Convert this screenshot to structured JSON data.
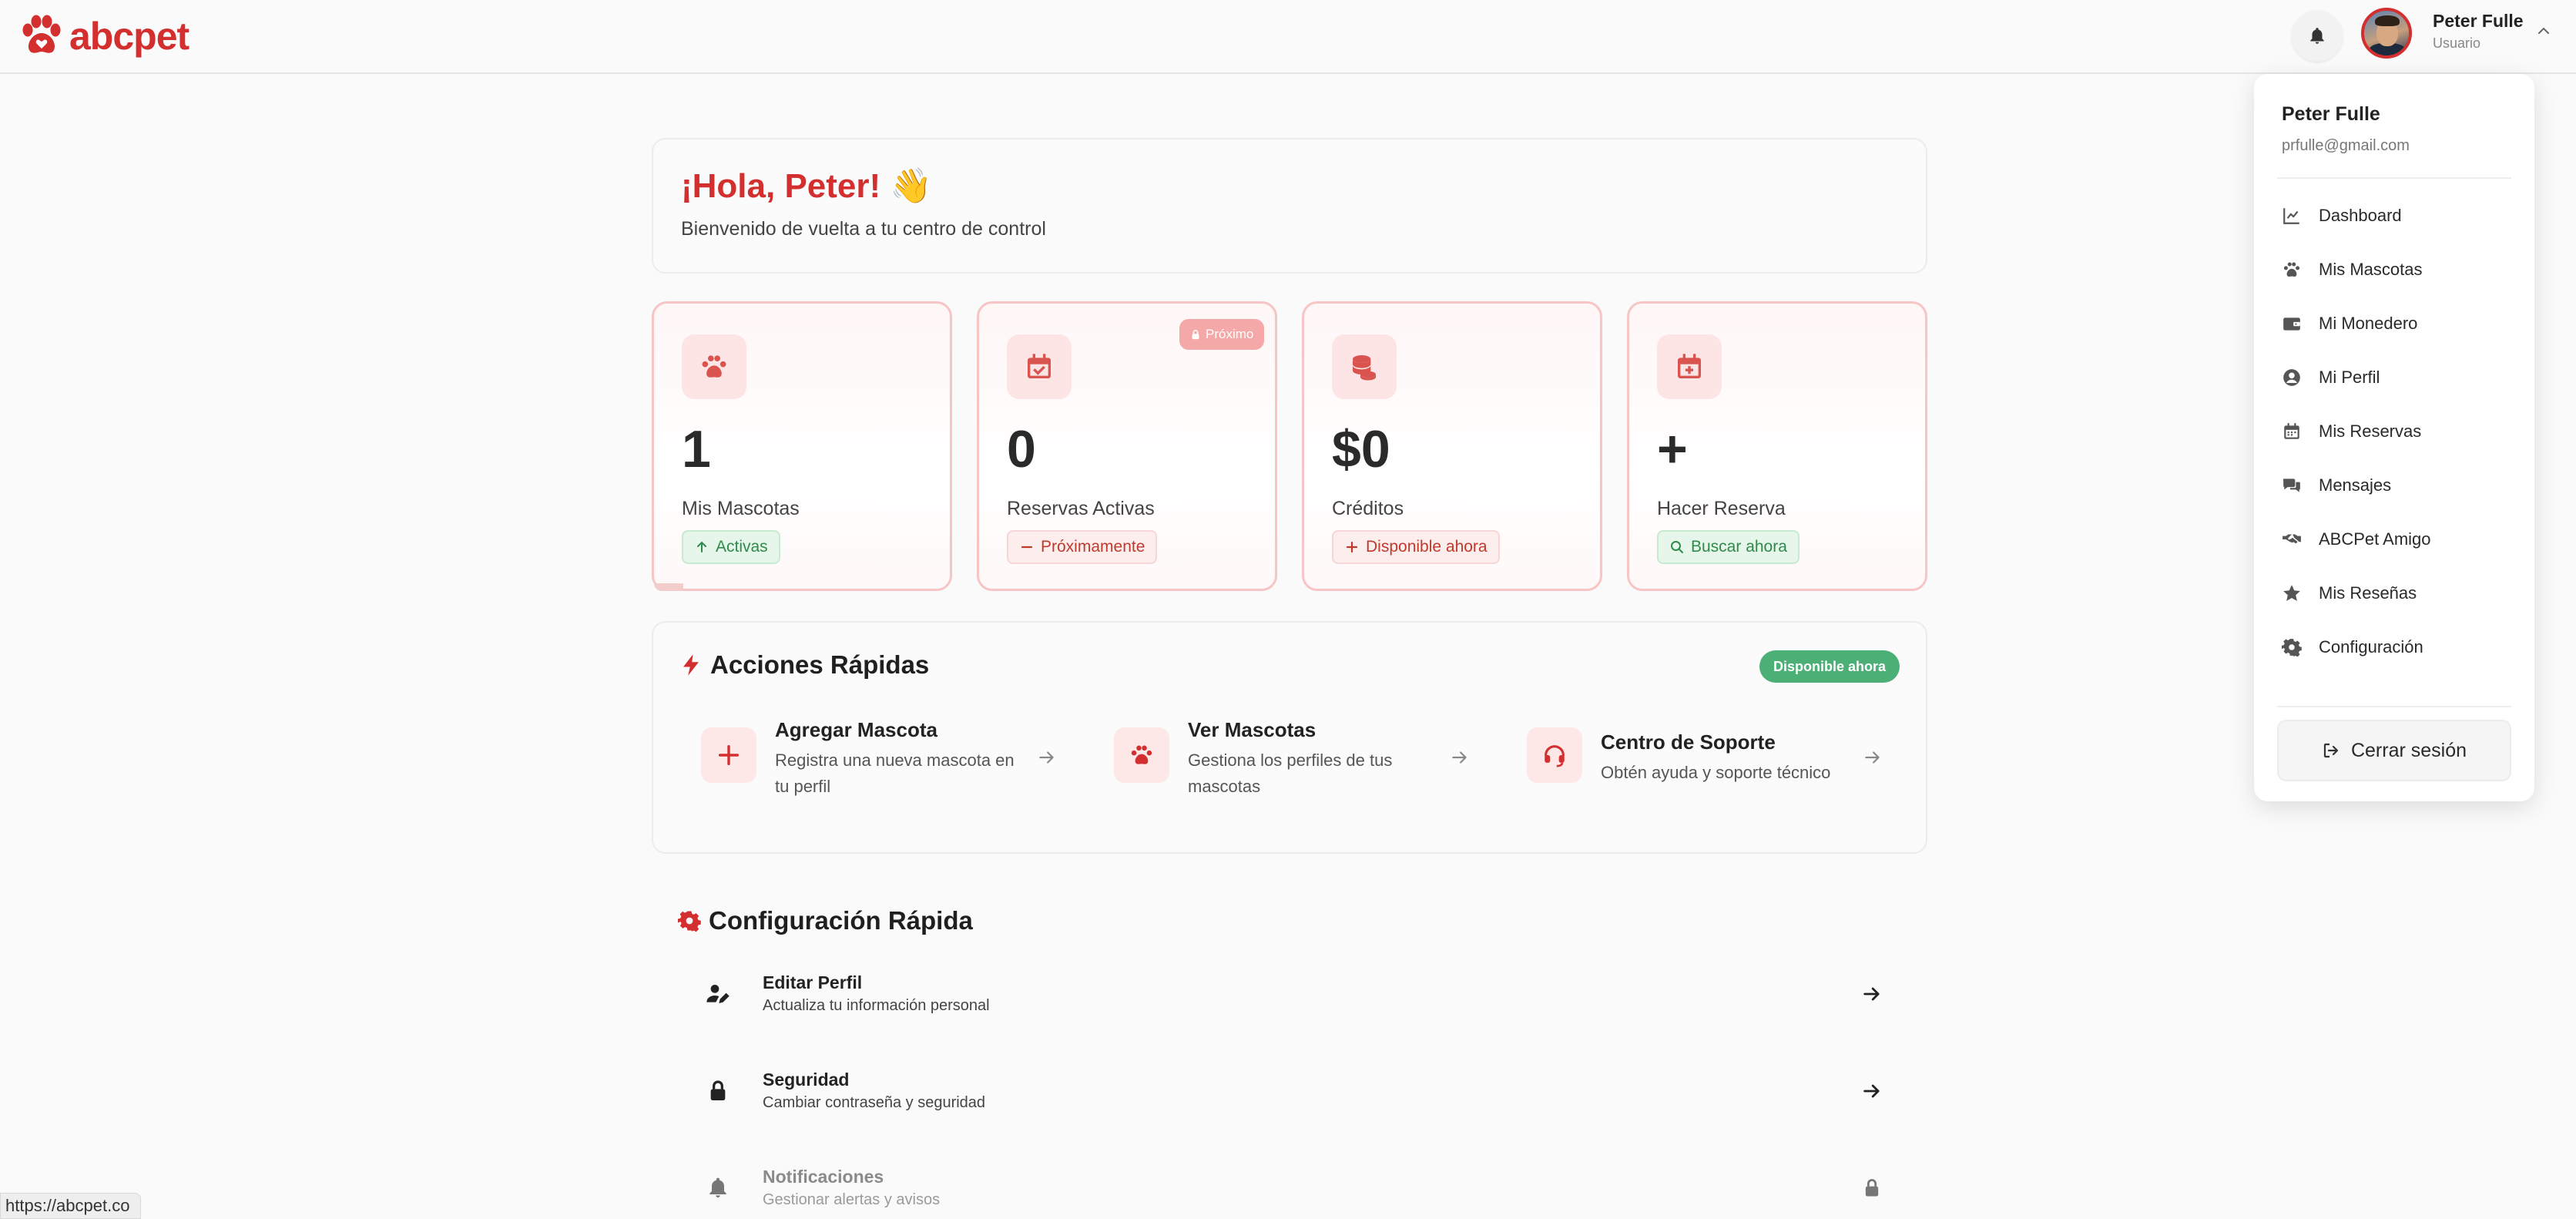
{
  "header": {
    "logo_text": "abcpet",
    "user_name": "Peter Fulle",
    "user_role": "Usuario"
  },
  "dropdown": {
    "name": "Peter Fulle",
    "email": "prfulle@gmail.com",
    "items": [
      {
        "label": "Dashboard",
        "icon": "chart-line-icon"
      },
      {
        "label": "Mis Mascotas",
        "icon": "paw-icon"
      },
      {
        "label": "Mi Monedero",
        "icon": "wallet-icon"
      },
      {
        "label": "Mi Perfil",
        "icon": "user-circle-icon"
      },
      {
        "label": "Mis Reservas",
        "icon": "calendar-icon"
      },
      {
        "label": "Mensajes",
        "icon": "chat-icon"
      },
      {
        "label": "ABCPet Amigo",
        "icon": "handshake-icon"
      },
      {
        "label": "Mis Reseñas",
        "icon": "star-icon"
      },
      {
        "label": "Configuración",
        "icon": "gear-icon"
      }
    ],
    "logout_label": "Cerrar sesión"
  },
  "greeting": {
    "title": "¡Hola, Peter! 👋",
    "subtitle": "Bienvenido de vuelta a tu centro de control"
  },
  "stats": [
    {
      "value": "1",
      "label": "Mis Mascotas",
      "badge": "Activas",
      "badge_icon": "arrow-up-icon",
      "icon": "paw-icon",
      "progress": 0.1
    },
    {
      "value": "0",
      "label": "Reservas Activas",
      "badge": "Próximamente",
      "badge_icon": "minus-icon",
      "icon": "calendar-icon",
      "tag": "Próximo"
    },
    {
      "value": "$0",
      "label": "Créditos",
      "badge": "Disponible ahora",
      "badge_icon": "plus-icon",
      "icon": "coins-icon"
    },
    {
      "value": "+",
      "label": "Hacer Reserva",
      "badge": "Buscar ahora",
      "badge_icon": "search-icon",
      "icon": "calendar-plus-icon"
    }
  ],
  "acciones": {
    "title": "Acciones Rápidas",
    "badge": "Disponible ahora",
    "items": [
      {
        "title": "Agregar Mascota",
        "desc": "Registra una nueva mascota en tu perfil",
        "icon": "plus-icon"
      },
      {
        "title": "Ver Mascotas",
        "desc": "Gestiona los perfiles de tus mascotas",
        "icon": "paw-icon"
      },
      {
        "title": "Centro de Soporte",
        "desc": "Obtén ayuda y soporte técnico",
        "icon": "headset-icon"
      }
    ]
  },
  "config": {
    "title": "Configuración Rápida",
    "items": [
      {
        "title": "Editar Perfil",
        "desc": "Actualiza tu información personal",
        "icon": "user-edit-icon"
      },
      {
        "title": "Seguridad",
        "desc": "Cambiar contraseña y seguridad",
        "icon": "lock-icon"
      },
      {
        "title": "Notificaciones",
        "desc": "Gestionar alertas y avisos",
        "icon": "bell-icon"
      }
    ]
  },
  "statusbar": {
    "url": "https://abcpet.co"
  },
  "colors": {
    "brand": "#d32f2f",
    "success": "#4caf76",
    "card_border": "#f7c5c5"
  }
}
